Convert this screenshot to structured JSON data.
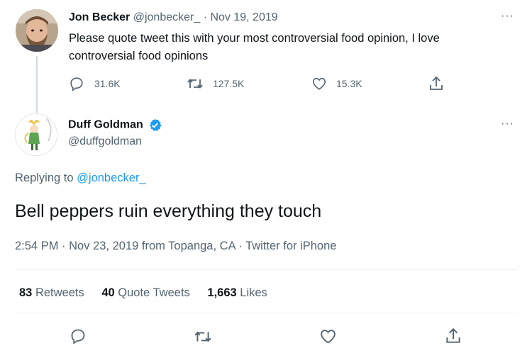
{
  "parent_tweet": {
    "name": "Jon Becker",
    "handle": "@jonbecker_",
    "separator": "·",
    "date": "Nov 19, 2019",
    "text": "Please quote tweet this with your most controversial food opinion, I love controversial food opinions",
    "replies": "31.6K",
    "retweets": "127.5K",
    "likes": "15.3K",
    "avatar_icon": "bearded-man-avatar"
  },
  "main_tweet": {
    "name": "Duff Goldman",
    "handle": "@duffgoldman",
    "verified_icon": "verified-badge-icon",
    "avatar_icon": "cartoon-prince-avatar",
    "replying_prefix": "Replying to",
    "replying_handle": "@jonbecker_",
    "text": "Bell peppers ruin everything they touch",
    "time": "2:54 PM",
    "date": "Nov 23, 2019",
    "location": "from Topanga, CA",
    "source": "Twitter for iPhone",
    "dot": "·",
    "stats": {
      "retweets_count": "83",
      "retweets_label": "Retweets",
      "quotes_count": "40",
      "quotes_label": "Quote Tweets",
      "likes_count": "1,663",
      "likes_label": "Likes"
    }
  },
  "more_glyph": "···",
  "colors": {
    "text": "#0f1419",
    "gray": "#536471",
    "link": "#1d9bf0",
    "divider": "#eff3f4"
  }
}
